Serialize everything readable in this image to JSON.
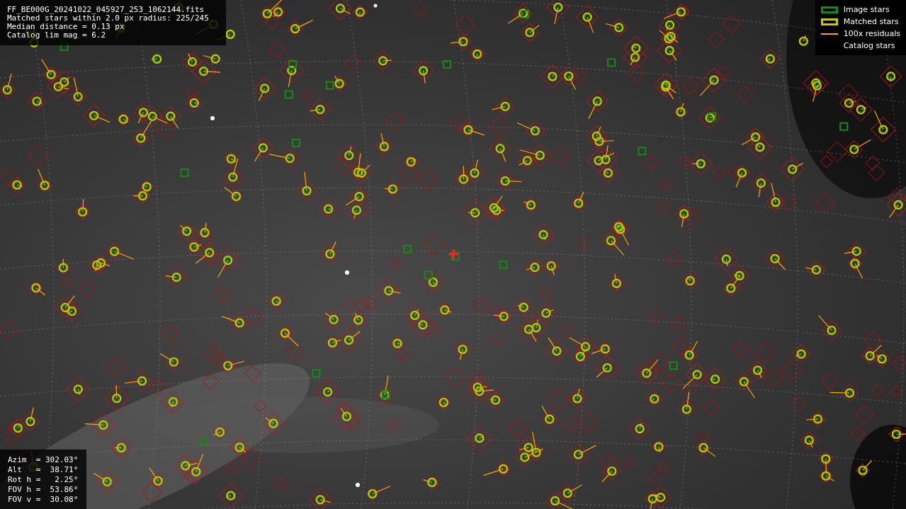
{
  "info": [
    "FF_BE000G_20241022_045927_253_1062144.fits",
    "Matched stars within 2.0 px radius: 225/245",
    "Median distance = 0.13 px",
    "Catalog lim mag = 6.2"
  ],
  "legend": [
    {
      "kind": "box",
      "label": "Image stars",
      "color": "#148a14"
    },
    {
      "kind": "box",
      "label": "Matched stars",
      "color": "#c8c800"
    },
    {
      "kind": "line",
      "label": "100x residuals",
      "color": "#ffa500"
    },
    {
      "kind": "hidden",
      "label": "Catalog stars"
    }
  ],
  "pointing": [
    "Azim  = 302.03°",
    "Alt   =  38.71°",
    "Rot h =   2.25°",
    "FOV h =  53.86°",
    "FOV v =  30.08°"
  ]
}
